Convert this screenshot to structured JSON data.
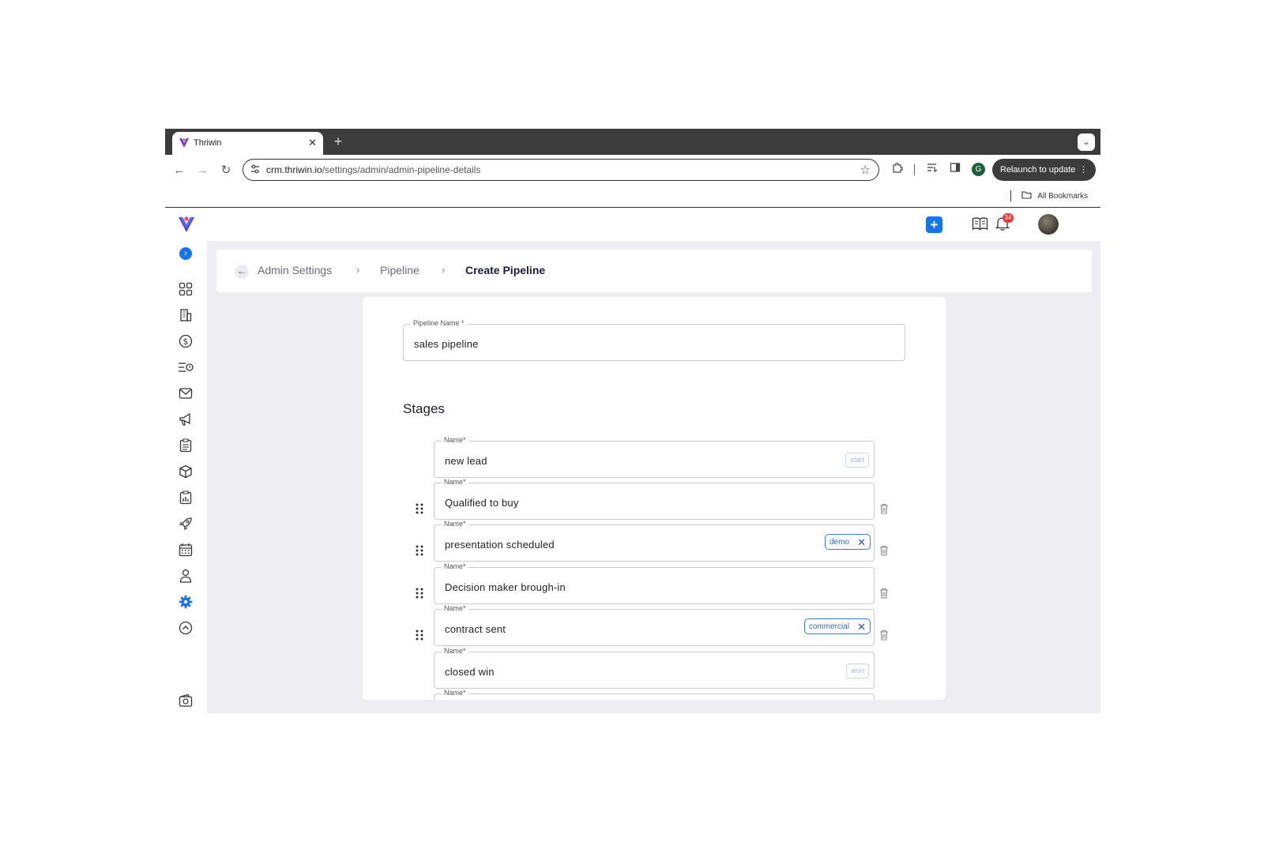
{
  "browser": {
    "tab_title": "Thriwin",
    "tab_close": "✕",
    "new_tab": "+",
    "url_host": "crm.thriwin.io",
    "url_path": "/settings/admin/admin-pipeline-details",
    "profile_initial": "G",
    "relaunch_label": "Relaunch to update",
    "bookmarks_label": "All Bookmarks"
  },
  "topbar": {
    "notification_count": "34"
  },
  "breadcrumb": {
    "items": [
      "Admin Settings",
      "Pipeline",
      "Create Pipeline"
    ]
  },
  "form": {
    "pipeline_name_label": "Pipeline Name *",
    "pipeline_name_value": "sales pipeline",
    "stages_heading": "Stages",
    "stage_label": "Name*",
    "stages": [
      {
        "name": "new lead",
        "tag": "start",
        "tag_style": "faint"
      },
      {
        "name": "Qualified to buy",
        "tag": "",
        "tag_style": "none"
      },
      {
        "name": "presentation scheduled",
        "tag": "demo",
        "tag_style": "removable"
      },
      {
        "name": "Decision maker brough-in",
        "tag": "",
        "tag_style": "none"
      },
      {
        "name": "contract sent",
        "tag": "commercial",
        "tag_style": "removable"
      },
      {
        "name": "closed win",
        "tag": "won",
        "tag_style": "faint"
      },
      {
        "name": "",
        "tag": "",
        "tag_style": "none"
      }
    ]
  },
  "colors": {
    "accent": "#1a73e8",
    "chip_border": "#3d7bd9",
    "content_bg": "#eeeef2",
    "badge_red": "#e53935"
  }
}
